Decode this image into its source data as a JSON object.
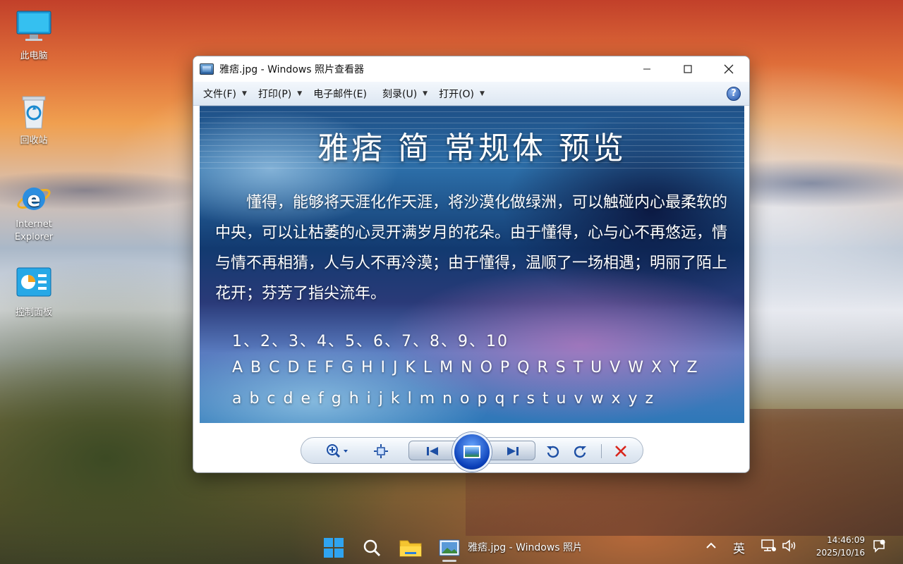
{
  "desktop": {
    "icons": [
      {
        "label": "此电脑",
        "icon": "computer-icon"
      },
      {
        "label": "回收站",
        "icon": "recycle-bin-icon"
      },
      {
        "label": "Internet Explorer",
        "icon": "internet-explorer-icon"
      },
      {
        "label": "控制面板",
        "icon": "control-panel-icon"
      }
    ]
  },
  "window": {
    "title": "雅痞.jpg - Windows 照片查看器",
    "menu": [
      {
        "label": "文件(F)",
        "has_dropdown": true
      },
      {
        "label": "打印(P)",
        "has_dropdown": true
      },
      {
        "label": "电子邮件(E)",
        "has_dropdown": false
      },
      {
        "label": "刻录(U)",
        "has_dropdown": true
      },
      {
        "label": "打开(O)",
        "has_dropdown": true
      }
    ],
    "help_label": "?"
  },
  "photo": {
    "heading": "雅痞 简 常规体 预览",
    "paragraph": "懂得，能够将天涯化作天涯，将沙漠化做绿洲，可以触碰内心最柔软的中央，可以让枯萎的心灵开满岁月的花朵。由于懂得，心与心不再悠远，情与情不再相猜，人与人不再冷漠；由于懂得，温顺了一场相遇；明丽了陌上花开；芬芳了指尖流年。",
    "digits": "1、2、3、4、5、6、7、8、9、10",
    "uppercase": "A B C D E F G H I J K L M N O P Q R S T U V W X Y Z",
    "lowercase": "a b c d e f g h i j k l m n o p q r s t u v w x y z"
  },
  "toolbar": {
    "buttons": [
      "zoom-icon",
      "fit-window-icon",
      "previous-icon",
      "slideshow-icon",
      "next-icon",
      "rotate-left-icon",
      "rotate-right-icon",
      "delete-icon"
    ]
  },
  "taskbar": {
    "app_label": "雅痞.jpg - Windows 照片查看器",
    "ime": "英",
    "time": "14:46:09",
    "date": "2025/10/16"
  },
  "colors": {
    "delete_red": "#d9261c",
    "accent_blue": "#1d4fa4"
  }
}
